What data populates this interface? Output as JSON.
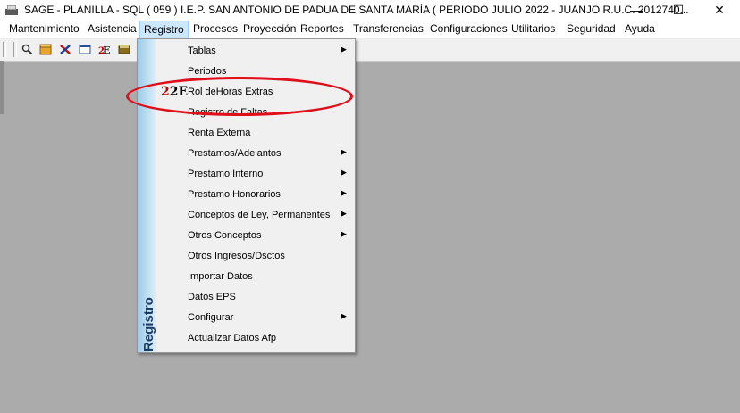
{
  "window": {
    "title": "SAGE - PLANILLA - SQL  ( 059 ) I.E.P. SAN ANTONIO DE PADUA DE SANTA MARÍA ( PERIODO JULIO 2022 - JUANJO  R.U.C. 2012740...",
    "minimize": "—",
    "maximize": "☐",
    "close": "✕"
  },
  "menubar": [
    "Mantenimiento",
    "Asistencia",
    "Registro",
    "Procesos",
    "Proyección",
    "Reportes",
    "Transferencias",
    "Configuraciones",
    "Utilitarios",
    "Seguridad",
    "Ayuda"
  ],
  "toolbar_icons": [
    "person-search-icon",
    "box-icon",
    "delete-x-icon",
    "window-icon",
    "2e-icon",
    "book-icon"
  ],
  "dropdown": {
    "side_label": "Registro",
    "items": [
      {
        "label": "Tablas",
        "submenu": true
      },
      {
        "label": "Periodos",
        "submenu": false
      },
      {
        "label": "Rol deHoras Extras",
        "submenu": false,
        "icon": "2E"
      },
      {
        "label": "Registro de Faltas",
        "submenu": false
      },
      {
        "label": "Renta Externa",
        "submenu": false
      },
      {
        "label": "Prestamos/Adelantos",
        "submenu": true
      },
      {
        "label": "Prestamo Interno",
        "submenu": true
      },
      {
        "label": "Prestamo Honorarios",
        "submenu": true
      },
      {
        "label": "Conceptos de Ley, Permanentes",
        "submenu": true
      },
      {
        "label": "Otros Conceptos",
        "submenu": true
      },
      {
        "label": "Otros Ingresos/Dsctos",
        "submenu": false
      },
      {
        "label": "Importar Datos",
        "submenu": false
      },
      {
        "label": "Datos EPS",
        "submenu": false
      },
      {
        "label": "Configurar",
        "submenu": true
      },
      {
        "label": "Actualizar Datos Afp",
        "submenu": false
      }
    ],
    "arrow": "▶"
  },
  "colors": {
    "annotation": "#e0101a",
    "active_menu": "#cce8ff"
  }
}
